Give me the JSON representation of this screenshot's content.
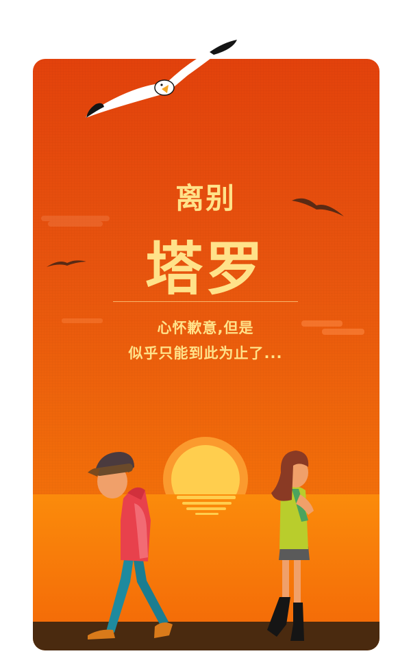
{
  "poster": {
    "subtitle": "离别",
    "title": "塔罗",
    "text_line_1": "心怀歉意,但是",
    "text_line_2": "似乎只能到此为止了..."
  },
  "colors": {
    "background": "#ffffff",
    "sky_top": "#e3420c",
    "sky_bottom": "#f57f10",
    "title": "#ffe28a",
    "ground": "#4a2a0f"
  }
}
